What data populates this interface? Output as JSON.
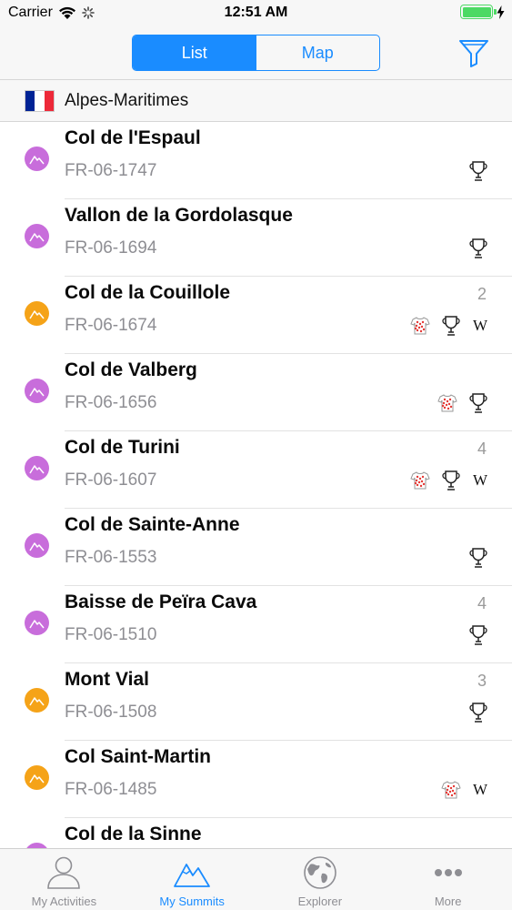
{
  "status_bar": {
    "carrier": "Carrier",
    "time": "12:51 AM",
    "battery_level": 1.0,
    "battery_color": "#4cd964"
  },
  "nav": {
    "segments": [
      "List",
      "Map"
    ],
    "selected_segment": "List",
    "accent_color": "#1a8cff",
    "filter_icon": "filter-funnel-icon"
  },
  "region": {
    "name": "Alpes-Maritimes",
    "flag_colors": [
      "#002395",
      "#ffffff",
      "#ed2939"
    ]
  },
  "summits": [
    {
      "name": "Col de l'Espaul",
      "code": "FR-06-1747",
      "count": "",
      "color": "purple",
      "badges": [
        "trophy-icon"
      ]
    },
    {
      "name": "Vallon de la Gordolasque",
      "code": "FR-06-1694",
      "count": "",
      "color": "purple",
      "badges": [
        "trophy-icon"
      ]
    },
    {
      "name": "Col de la Couillole",
      "code": "FR-06-1674",
      "count": "2",
      "color": "orange",
      "badges": [
        "polka-dot-jersey-icon",
        "trophy-icon",
        "wikipedia-icon"
      ]
    },
    {
      "name": "Col de Valberg",
      "code": "FR-06-1656",
      "count": "",
      "color": "purple",
      "badges": [
        "polka-dot-jersey-icon",
        "trophy-icon"
      ]
    },
    {
      "name": "Col de Turini",
      "code": "FR-06-1607",
      "count": "4",
      "color": "purple",
      "badges": [
        "polka-dot-jersey-icon",
        "trophy-icon",
        "wikipedia-icon"
      ]
    },
    {
      "name": "Col de Sainte-Anne",
      "code": "FR-06-1553",
      "count": "",
      "color": "purple",
      "badges": [
        "trophy-icon"
      ]
    },
    {
      "name": "Baisse de Peïra Cava",
      "code": "FR-06-1510",
      "count": "4",
      "color": "purple",
      "badges": [
        "trophy-icon"
      ]
    },
    {
      "name": "Mont Vial",
      "code": "FR-06-1508",
      "count": "3",
      "color": "orange",
      "badges": [
        "trophy-icon"
      ]
    },
    {
      "name": "Col Saint-Martin",
      "code": "FR-06-1485",
      "count": "",
      "color": "orange",
      "badges": [
        "polka-dot-jersey-icon",
        "wikipedia-icon"
      ]
    },
    {
      "name": "Col de la Sinne",
      "code": "",
      "count": "",
      "color": "purple",
      "badges": []
    }
  ],
  "wiki_letter": "W",
  "tabs": [
    {
      "label": "My Activities",
      "icon": "person-icon",
      "active": false
    },
    {
      "label": "My Summits",
      "icon": "mountains-icon",
      "active": true
    },
    {
      "label": "Explorer",
      "icon": "globe-icon",
      "active": false
    },
    {
      "label": "More",
      "icon": "more-dots-icon",
      "active": false
    }
  ],
  "colors": {
    "purple": "#c86ddb",
    "orange": "#f5a318",
    "active_tab": "#1a8cff",
    "inactive_tab": "#8e8e93"
  }
}
